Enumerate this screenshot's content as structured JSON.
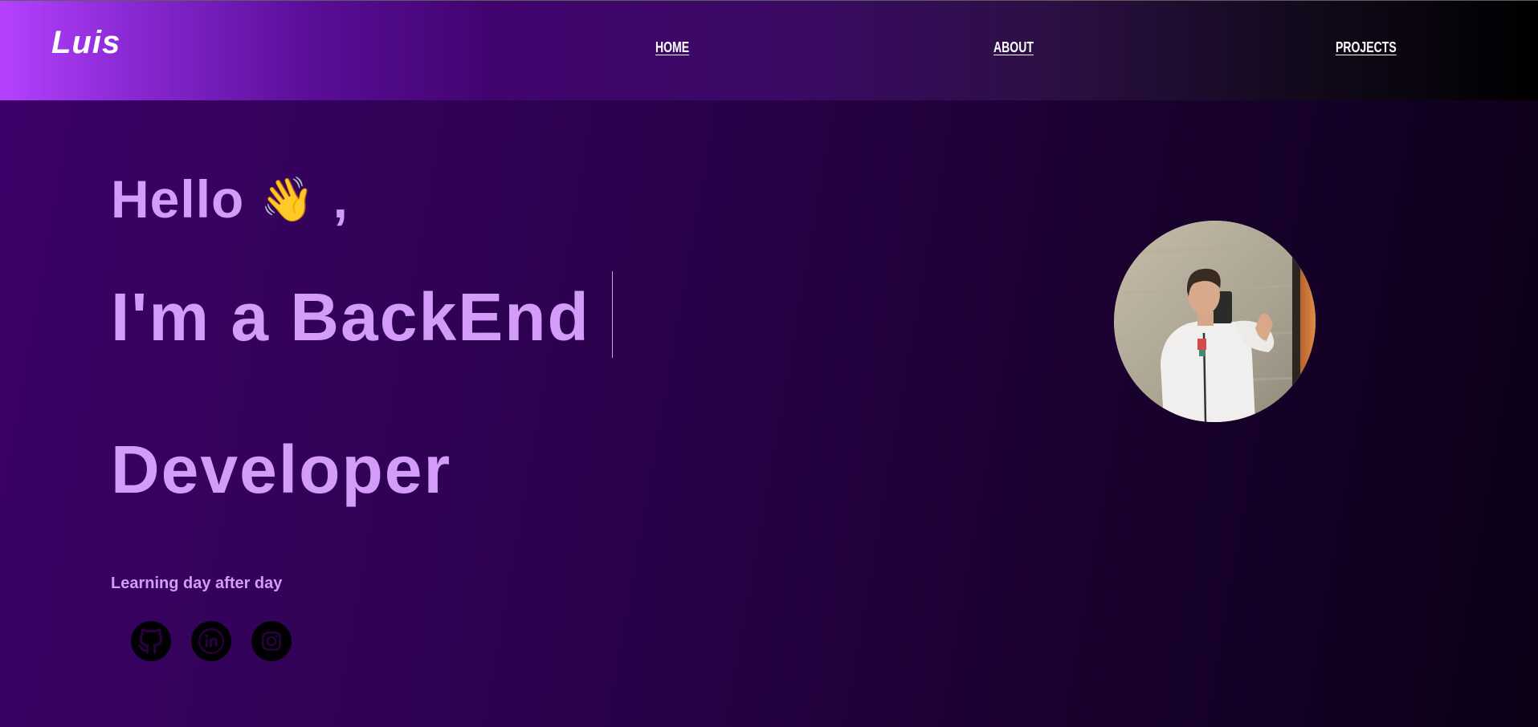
{
  "header": {
    "logo": "Luis",
    "nav": [
      "HOME",
      "ABOUT",
      "PROJECTS"
    ]
  },
  "hero": {
    "greeting": "Hello",
    "greeting_comma": ",",
    "wave_emoji": "👋",
    "headline_line1": "I'm a BackEnd",
    "headline_line2": "Developer",
    "tagline": "Learning day after day"
  },
  "social": [
    "github-icon",
    "linkedin-icon",
    "instagram-icon"
  ],
  "colors": {
    "accent_text": "#d39cf8",
    "nav_gradient_start": "#b541ff",
    "nav_gradient_end": "#000000",
    "background_start": "#3d0169",
    "background_end": "#0c0016"
  }
}
